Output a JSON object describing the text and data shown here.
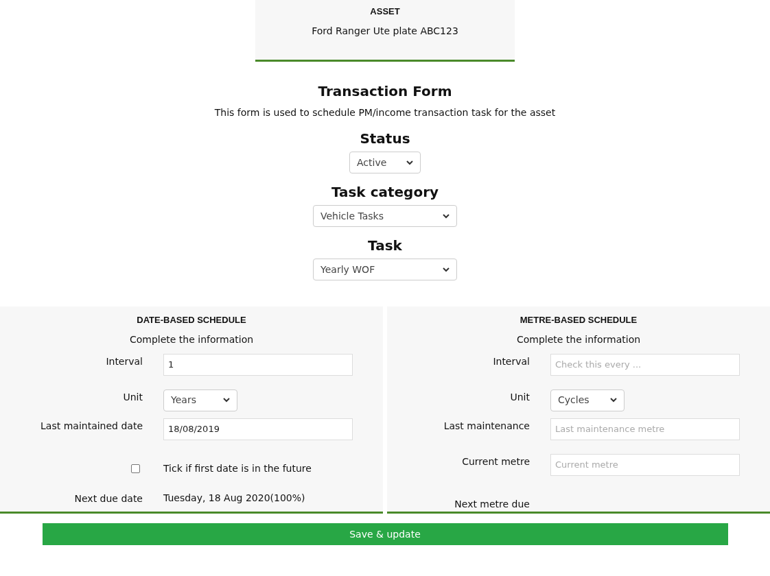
{
  "asset": {
    "heading": "ASSET",
    "name": "Ford Ranger Ute plate ABC123"
  },
  "form": {
    "title": "Transaction Form",
    "description": "This form is used to schedule PM/income transaction task for the asset"
  },
  "selectors": [
    {
      "label": "Status",
      "value": "Active",
      "kind": "compact"
    },
    {
      "label": "Task category",
      "value": "Vehicle Tasks",
      "kind": "wide"
    },
    {
      "label": "Task",
      "value": "Yearly WOF",
      "kind": "wide"
    }
  ],
  "schedules": [
    {
      "title": "DATE-BASED SCHEDULE",
      "subtitle": "Complete the information",
      "rows": [
        {
          "kind": "input",
          "label": "Interval",
          "value": "1"
        },
        {
          "kind": "select",
          "label": "Unit",
          "value": "Years"
        },
        {
          "kind": "input",
          "label": "Last maintained date",
          "value": "18/08/2019"
        },
        {
          "kind": "checkbox",
          "checked": false,
          "text": "Tick if first date is in the future"
        },
        {
          "kind": "info",
          "label": "Next due date",
          "value": "Tuesday, 18 Aug 2020(100%)"
        }
      ]
    },
    {
      "title": "METRE-BASED SCHEDULE",
      "subtitle": "Complete the information",
      "rows": [
        {
          "kind": "input",
          "label": "Interval",
          "placeholder": "Check this every ..."
        },
        {
          "kind": "select",
          "label": "Unit",
          "value": "Cycles"
        },
        {
          "kind": "input",
          "label": "Last maintenance",
          "placeholder": "Last maintenance metre"
        },
        {
          "kind": "input",
          "label": "Current metre",
          "placeholder": "Current metre"
        },
        {
          "kind": "info",
          "label": "Next metre due"
        }
      ]
    }
  ],
  "save_button": "Save & update"
}
